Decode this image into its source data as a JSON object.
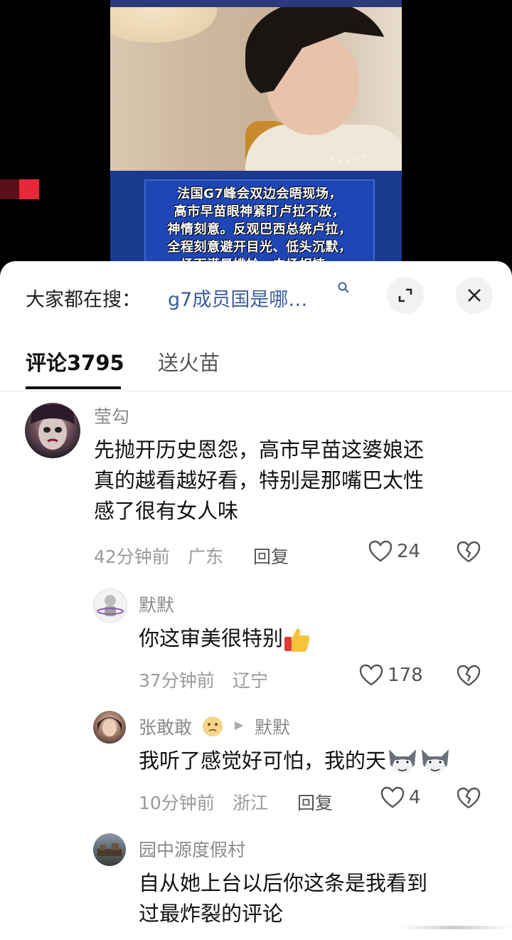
{
  "video": {
    "caption_lines": [
      "法国G7峰会双边会晤现场，",
      "高市早苗眼神紧盯卢拉不放，",
      "神情刻意。反观巴西总统卢拉，",
      "全程刻意避开目光、低头沉默，",
      "场面满是尴尬，立场相悖。"
    ]
  },
  "search": {
    "label": "大家都在搜：",
    "term": "g7成员国是哪…"
  },
  "tabs": {
    "comments_label": "评论3795",
    "fire_label": "送火苗"
  },
  "comments": [
    {
      "name": "莹勾",
      "lines": [
        "先抛开历史恩怨，高市早苗这婆娘还",
        "真的越看越好看，特别是那嘴巴太性",
        "感了很有女人味"
      ],
      "time": "42分钟前",
      "location": "广东",
      "reply": "回复",
      "likes": "24"
    },
    {
      "name": "默默",
      "text": "你这审美很特别",
      "time": "37分钟前",
      "location": "辽宁",
      "likes": "178"
    },
    {
      "name": "张敢敢",
      "reply_to": "默默",
      "text": "我听了感觉好可怕，我的天",
      "time": "10分钟前",
      "location": "浙江",
      "reply": "回复",
      "likes": "4"
    },
    {
      "name": "园中源度假村",
      "lines": [
        "自从她上台以后你这条是我看到",
        "过最炸裂的评论"
      ]
    }
  ],
  "colors": {
    "accent_link": "#3d5d9a",
    "caption_bg": "#1e46b4",
    "red_marker": "#e8283a"
  }
}
